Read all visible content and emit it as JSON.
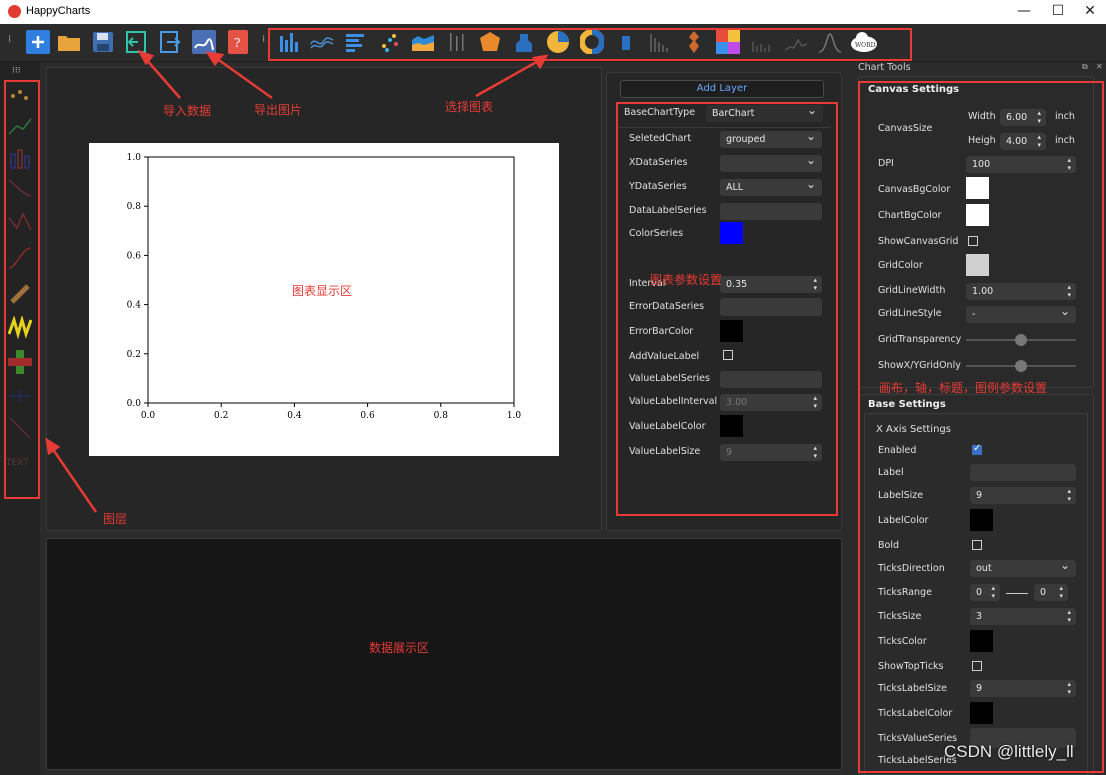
{
  "window": {
    "title": "HappyCharts",
    "minimize": "—",
    "maximize": "☐",
    "close": "✕"
  },
  "toolbar": {
    "file_icons": [
      "new-file-icon",
      "open-folder-icon",
      "save-icon",
      "import-data-icon",
      "export-image-icon",
      "image-edit-icon",
      "pdf-icon"
    ],
    "chart_icons": [
      "bar-chart-icon",
      "line-chart-icon",
      "horizontal-bar-icon",
      "scatter-icon",
      "area-chart-icon",
      "column-icon",
      "polygon-icon",
      "3d-bar-icon",
      "pie-chart-icon",
      "donut-chart-icon",
      "box-icon",
      "histogram-icon",
      "violin-icon",
      "heatmap-icon",
      "small-bar-icon",
      "ridge-icon",
      "kde-icon",
      "wordcloud-icon"
    ],
    "wordcloud_label": "WORD"
  },
  "layers": {
    "text_label": "TEXT"
  },
  "annotations": {
    "import": "导入数据",
    "export": "导出图片",
    "select_chart": "选择图表",
    "layers": "图层",
    "chart_display": "图表显示区",
    "chart_params": "图表参数设置",
    "data_display": "数据展示区",
    "canvas_params": "画布，轴，标题，图例参数设置"
  },
  "figure": {
    "yticks": [
      "1.0",
      "0.8",
      "0.6",
      "0.4",
      "0.2",
      "0.0"
    ],
    "xticks": [
      "0.0",
      "0.2",
      "0.4",
      "0.6",
      "0.8",
      "1.0"
    ]
  },
  "layer_panel": {
    "add_layer": "Add Layer",
    "base_chart_type_label": "BaseChartType",
    "base_chart_type_value": "BarChart",
    "rows": [
      {
        "label": "SeletedChart",
        "value": "grouped"
      },
      {
        "label": "XDataSeries",
        "value": ""
      },
      {
        "label": "YDataSeries",
        "value": "ALL"
      },
      {
        "label": "DataLabelSeries",
        "value": ""
      },
      {
        "label": "ColorSeries"
      },
      {
        "label": "Interval",
        "value": "0.35"
      },
      {
        "label": "ErrorDataSeries",
        "value": ""
      },
      {
        "label": "ErrorBarColor"
      },
      {
        "label": "AddValueLabel"
      },
      {
        "label": "ValueLabelSeries",
        "value": ""
      },
      {
        "label": "ValueLabelInterval",
        "value": "3.00"
      },
      {
        "label": "ValueLabelColor"
      },
      {
        "label": "ValueLabelSize",
        "value": "9"
      }
    ],
    "color_series": "#0000ff",
    "error_bar_color": "#000000",
    "value_label_color": "#000000"
  },
  "chart_tools": {
    "title": "Chart Tools",
    "canvas_settings": {
      "title": "Canvas Settings",
      "canvas_size_label": "CanvasSize",
      "width_label": "Width",
      "width_value": "6.00",
      "width_unit": "inch",
      "height_label": "Heigh",
      "height_value": "4.00",
      "height_unit": "inch",
      "dpi_label": "DPI",
      "dpi_value": "100",
      "canvas_bg_label": "CanvasBgColor",
      "chart_bg_label": "ChartBgColor",
      "show_grid_label": "ShowCanvasGrid",
      "grid_color_label": "GridColor",
      "grid_line_width_label": "GridLineWidth",
      "grid_line_width_value": "1.00",
      "grid_line_style_label": "GridLineStyle",
      "grid_line_style_value": "-",
      "grid_transparency_label": "GridTransparency",
      "show_xy_grid_label": "ShowX/YGridOnly",
      "canvas_bg_color": "#ffffff",
      "chart_bg_color": "#ffffff",
      "grid_color": "#d0d0d0"
    },
    "base_settings": {
      "title": "Base Settings",
      "x_axis_title": "X Axis Settings",
      "enabled_label": "Enabled",
      "label_label": "Label",
      "label_value": "",
      "label_size_label": "LabelSize",
      "label_size_value": "9",
      "label_color_label": "LabelColor",
      "bold_label": "Bold",
      "ticks_direction_label": "TicksDirection",
      "ticks_direction_value": "out",
      "ticks_range_label": "TicksRange",
      "ticks_range_min": "0",
      "ticks_range_max": "0",
      "ticks_size_label": "TicksSize",
      "ticks_size_value": "3",
      "ticks_color_label": "TicksColor",
      "show_top_ticks_label": "ShowTopTicks",
      "ticks_label_size_label": "TicksLabelSize",
      "ticks_label_size_value": "9",
      "ticks_label_color_label": "TicksLabelColor",
      "ticks_value_series_label": "TicksValueSeries",
      "ticks_label_series_label": "TicksLabelSeries"
    }
  },
  "watermark": "CSDN @littlely_ll"
}
